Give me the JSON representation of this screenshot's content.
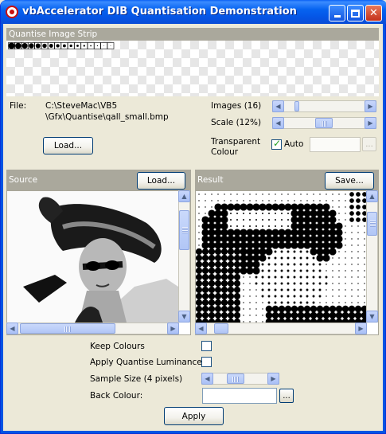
{
  "window": {
    "title": "vbAccelerator DIB Quantisation Demonstration",
    "controls": {
      "minimize": "minimize",
      "maximize": "maximize",
      "close": "✕"
    }
  },
  "strip": {
    "header": "Quantise Image Strip"
  },
  "file": {
    "label": "File:",
    "path_line1": "C:\\SteveMac\\VB5",
    "path_line2": "\\Gfx\\Quantise\\qall_small.bmp",
    "load_button": "Load..."
  },
  "images": {
    "label": "Images (16)",
    "count": 16
  },
  "scale": {
    "label": "Scale (12%)",
    "percent": 12
  },
  "transparent": {
    "label_line1": "Transparent",
    "label_line2": "Colour",
    "auto_label": "Auto",
    "auto_checked": true,
    "ellipsis": "..."
  },
  "source": {
    "header": "Source",
    "load_button": "Load..."
  },
  "result": {
    "header": "Result",
    "save_button": "Save..."
  },
  "options": {
    "keep_colours": "Keep Colours",
    "apply_luminance": "Apply Quantise Luminance",
    "sample_size": "Sample Size (4 pixels)",
    "back_colour": "Back Colour:",
    "ellipsis": "..."
  },
  "apply_button": "Apply",
  "colors": {
    "title_blue": "#0663f0",
    "face": "#ece9d8",
    "header_gray": "#aaa89c"
  }
}
